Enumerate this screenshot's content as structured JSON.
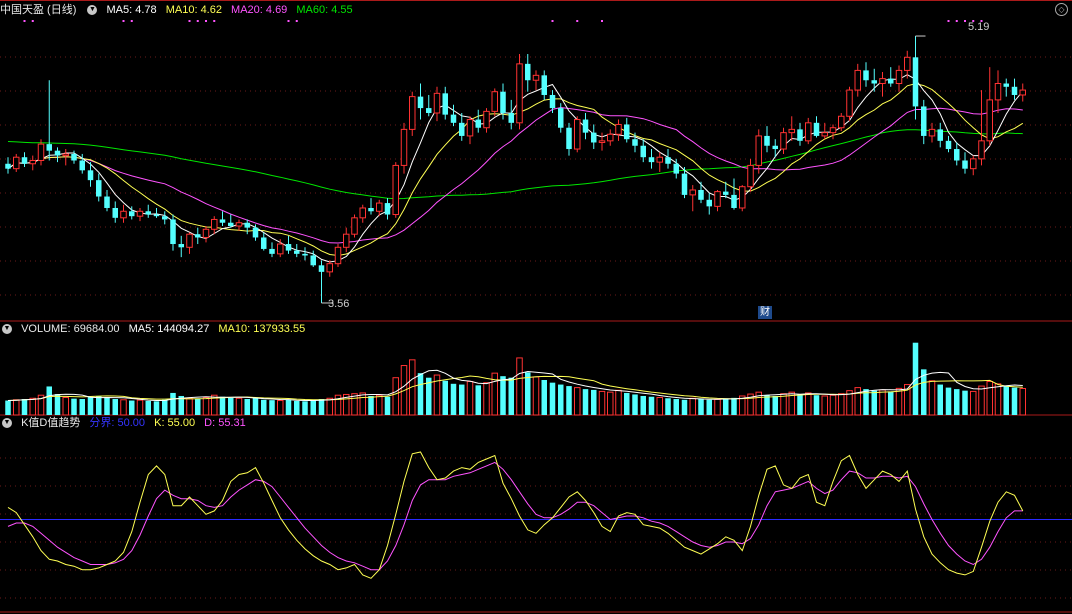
{
  "header": {
    "title": "中国天盈 (日线)",
    "ma5_label": "MA5: 4.78",
    "ma10_label": "MA10: 4.62",
    "ma20_label": "MA20: 4.69",
    "ma60_label": "MA60: 4.55"
  },
  "volume_header": {
    "label": "VOLUME: 69684.00",
    "ma5_label": "MA5: 144094.27",
    "ma10_label": "MA10: 137933.55"
  },
  "kd_header": {
    "title": "K值D值趋势",
    "divider_label": "分界: 50.00",
    "k_label": "K: 55.00",
    "d_label": "D: 55.31"
  },
  "annotations": {
    "high_label": "5.19",
    "low_label": "3.56",
    "finance_marker": "财"
  },
  "colors": {
    "up": "#ff3232",
    "down": "#54ffff",
    "ma5": "#ffffff",
    "ma10": "#ffff54",
    "ma20": "#ff54ff",
    "ma60": "#00e600",
    "panel_border": "#aa1a1a",
    "divider_line": "#2a2aff",
    "k_line": "#ffff54",
    "d_line": "#ff54ff"
  },
  "icons": {
    "panel_toggle": "chevron-down-icon",
    "corner": "expand-icon"
  },
  "chart_data": {
    "type": "candlestick",
    "candles": [
      [
        4.41,
        4.45,
        4.35,
        4.38
      ],
      [
        4.38,
        4.47,
        4.36,
        4.45
      ],
      [
        4.45,
        4.48,
        4.39,
        4.41
      ],
      [
        4.41,
        4.46,
        4.37,
        4.43
      ],
      [
        4.43,
        4.56,
        4.4,
        4.53
      ],
      [
        4.53,
        4.92,
        4.43,
        4.49
      ],
      [
        4.49,
        4.51,
        4.42,
        4.46
      ],
      [
        4.46,
        4.5,
        4.4,
        4.47
      ],
      [
        4.47,
        4.49,
        4.41,
        4.43
      ],
      [
        4.43,
        4.47,
        4.35,
        4.37
      ],
      [
        4.37,
        4.42,
        4.27,
        4.31
      ],
      [
        4.31,
        4.35,
        4.18,
        4.21
      ],
      [
        4.21,
        4.25,
        4.12,
        4.14
      ],
      [
        4.14,
        4.18,
        4.05,
        4.08
      ],
      [
        4.08,
        4.16,
        4.05,
        4.12
      ],
      [
        4.12,
        4.15,
        4.07,
        4.09
      ],
      [
        4.09,
        4.14,
        4.06,
        4.12
      ],
      [
        4.12,
        4.16,
        4.08,
        4.1
      ],
      [
        4.1,
        4.14,
        4.08,
        4.09
      ],
      [
        4.09,
        4.12,
        4.04,
        4.07
      ],
      [
        4.07,
        4.1,
        3.88,
        3.92
      ],
      [
        3.92,
        3.97,
        3.84,
        3.9
      ],
      [
        3.9,
        3.99,
        3.86,
        3.98
      ],
      [
        3.98,
        4.02,
        3.92,
        3.96
      ],
      [
        3.96,
        4.03,
        3.93,
        4.01
      ],
      [
        4.01,
        4.09,
        3.98,
        4.07
      ],
      [
        4.07,
        4.12,
        4.03,
        4.05
      ],
      [
        4.05,
        4.1,
        4.02,
        4.03
      ],
      [
        4.03,
        4.07,
        4.0,
        4.05
      ],
      [
        4.05,
        4.07,
        3.98,
        4.02
      ],
      [
        4.02,
        4.04,
        3.94,
        3.96
      ],
      [
        3.96,
        3.99,
        3.88,
        3.89
      ],
      [
        3.89,
        3.93,
        3.84,
        3.86
      ],
      [
        3.86,
        3.95,
        3.84,
        3.92
      ],
      [
        3.92,
        3.97,
        3.86,
        3.88
      ],
      [
        3.88,
        3.92,
        3.84,
        3.86
      ],
      [
        3.86,
        3.9,
        3.82,
        3.85
      ],
      [
        3.85,
        3.88,
        3.78,
        3.79
      ],
      [
        3.79,
        3.82,
        3.56,
        3.75
      ],
      [
        3.75,
        3.82,
        3.72,
        3.8
      ],
      [
        3.8,
        3.92,
        3.78,
        3.9
      ],
      [
        3.9,
        4.02,
        3.87,
        3.98
      ],
      [
        3.98,
        4.1,
        3.96,
        4.08
      ],
      [
        4.08,
        4.16,
        4.05,
        4.14
      ],
      [
        4.14,
        4.2,
        4.1,
        4.12
      ],
      [
        4.12,
        4.19,
        4.09,
        4.17
      ],
      [
        4.17,
        4.2,
        4.07,
        4.1
      ],
      [
        4.1,
        4.42,
        4.08,
        4.4
      ],
      [
        4.4,
        4.66,
        4.35,
        4.62
      ],
      [
        4.62,
        4.85,
        4.58,
        4.82
      ],
      [
        4.82,
        4.9,
        4.68,
        4.75
      ],
      [
        4.75,
        4.83,
        4.7,
        4.72
      ],
      [
        4.72,
        4.88,
        4.67,
        4.84
      ],
      [
        4.84,
        4.88,
        4.68,
        4.71
      ],
      [
        4.71,
        4.77,
        4.64,
        4.66
      ],
      [
        4.66,
        4.72,
        4.55,
        4.58
      ],
      [
        4.58,
        4.7,
        4.53,
        4.68
      ],
      [
        4.68,
        4.74,
        4.6,
        4.63
      ],
      [
        4.63,
        4.75,
        4.6,
        4.73
      ],
      [
        4.73,
        4.87,
        4.7,
        4.85
      ],
      [
        4.85,
        4.9,
        4.68,
        4.72
      ],
      [
        4.72,
        4.8,
        4.62,
        4.66
      ],
      [
        4.66,
        5.08,
        4.62,
        5.02
      ],
      [
        5.02,
        5.08,
        4.85,
        4.92
      ],
      [
        4.92,
        4.98,
        4.86,
        4.95
      ],
      [
        4.95,
        4.98,
        4.8,
        4.83
      ],
      [
        4.83,
        4.86,
        4.72,
        4.75
      ],
      [
        4.75,
        4.78,
        4.6,
        4.63
      ],
      [
        4.63,
        4.66,
        4.46,
        4.5
      ],
      [
        4.5,
        4.7,
        4.48,
        4.68
      ],
      [
        4.68,
        4.72,
        4.56,
        4.6
      ],
      [
        4.6,
        4.65,
        4.5,
        4.54
      ],
      [
        4.54,
        4.6,
        4.49,
        4.55
      ],
      [
        4.55,
        4.62,
        4.52,
        4.59
      ],
      [
        4.59,
        4.68,
        4.55,
        4.65
      ],
      [
        4.65,
        4.69,
        4.54,
        4.56
      ],
      [
        4.56,
        4.6,
        4.48,
        4.52
      ],
      [
        4.52,
        4.56,
        4.42,
        4.45
      ],
      [
        4.45,
        4.5,
        4.38,
        4.42
      ],
      [
        4.42,
        4.48,
        4.36,
        4.45
      ],
      [
        4.45,
        4.5,
        4.38,
        4.41
      ],
      [
        4.41,
        4.44,
        4.32,
        4.35
      ],
      [
        4.35,
        4.39,
        4.2,
        4.22
      ],
      [
        4.22,
        4.28,
        4.12,
        4.25
      ],
      [
        4.25,
        4.3,
        4.17,
        4.19
      ],
      [
        4.19,
        4.23,
        4.1,
        4.15
      ],
      [
        4.15,
        4.25,
        4.12,
        4.24
      ],
      [
        4.24,
        4.3,
        4.2,
        4.22
      ],
      [
        4.22,
        4.32,
        4.13,
        4.14
      ],
      [
        4.14,
        4.28,
        4.12,
        4.27
      ],
      [
        4.27,
        4.44,
        4.24,
        4.4
      ],
      [
        4.4,
        4.62,
        4.35,
        4.58
      ],
      [
        4.58,
        4.64,
        4.48,
        4.52
      ],
      [
        4.52,
        4.56,
        4.45,
        4.5
      ],
      [
        4.5,
        4.63,
        4.47,
        4.6
      ],
      [
        4.6,
        4.7,
        4.55,
        4.62
      ],
      [
        4.62,
        4.66,
        4.52,
        4.55
      ],
      [
        4.55,
        4.69,
        4.53,
        4.66
      ],
      [
        4.66,
        4.7,
        4.57,
        4.58
      ],
      [
        4.58,
        4.66,
        4.56,
        4.6
      ],
      [
        4.6,
        4.65,
        4.56,
        4.63
      ],
      [
        4.63,
        4.72,
        4.61,
        4.7
      ],
      [
        4.7,
        4.88,
        4.67,
        4.86
      ],
      [
        4.86,
        5.02,
        4.82,
        4.98
      ],
      [
        4.98,
        5.03,
        4.88,
        4.92
      ],
      [
        4.92,
        4.99,
        4.85,
        4.9
      ],
      [
        4.9,
        4.97,
        4.82,
        4.93
      ],
      [
        4.93,
        5.0,
        4.88,
        4.9
      ],
      [
        4.9,
        5.01,
        4.85,
        4.98
      ],
      [
        4.98,
        5.1,
        4.93,
        5.06
      ],
      [
        5.06,
        5.19,
        4.68,
        4.76
      ],
      [
        4.76,
        4.8,
        4.53,
        4.58
      ],
      [
        4.58,
        4.66,
        4.54,
        4.62
      ],
      [
        4.62,
        4.66,
        4.51,
        4.55
      ],
      [
        4.55,
        4.58,
        4.48,
        4.5
      ],
      [
        4.5,
        4.54,
        4.4,
        4.43
      ],
      [
        4.43,
        4.48,
        4.35,
        4.38
      ],
      [
        4.38,
        4.46,
        4.34,
        4.44
      ],
      [
        4.44,
        4.86,
        4.4,
        4.55
      ],
      [
        4.55,
        5.0,
        4.52,
        4.8
      ],
      [
        4.8,
        4.98,
        4.72,
        4.9
      ],
      [
        4.9,
        4.93,
        4.82,
        4.88
      ],
      [
        4.88,
        4.93,
        4.8,
        4.83
      ],
      [
        4.83,
        4.9,
        4.79,
        4.86
      ]
    ],
    "ma_lines": [
      "MA5",
      "MA10",
      "MA20",
      "MA60"
    ],
    "price_range": [
      3.45,
      5.3
    ],
    "high_annotation": 5.19,
    "low_annotation": 3.56,
    "volume": [
      38000,
      40000,
      42000,
      44000,
      52000,
      75000,
      55000,
      46000,
      43000,
      42000,
      48000,
      50000,
      47000,
      42000,
      40000,
      38000,
      39000,
      37000,
      36000,
      40000,
      58000,
      50000,
      44000,
      43000,
      46000,
      52000,
      48000,
      45000,
      44000,
      42000,
      45000,
      40000,
      39000,
      38000,
      41000,
      37000,
      36000,
      39000,
      42000,
      44000,
      52000,
      54000,
      56000,
      58000,
      50000,
      52000,
      48000,
      98000,
      130000,
      145000,
      110000,
      98000,
      105000,
      90000,
      82000,
      80000,
      88000,
      78000,
      85000,
      110000,
      102000,
      98000,
      150000,
      112000,
      100000,
      92000,
      85000,
      80000,
      76000,
      72000,
      68000,
      66000,
      62000,
      60000,
      65000,
      58000,
      54000,
      50000,
      48000,
      46000,
      44000,
      42000,
      40000,
      44000,
      42000,
      40000,
      41000,
      43000,
      45000,
      50000,
      55000,
      60000,
      52000,
      50000,
      56000,
      60000,
      54000,
      58000,
      52000,
      50000,
      52000,
      56000,
      64000,
      72000,
      68000,
      64000,
      66000,
      62000,
      70000,
      80000,
      190000,
      120000,
      90000,
      80000,
      72000,
      68000,
      64000,
      62000,
      76000,
      88000,
      82000,
      76000,
      72000,
      69684
    ],
    "volume_range": [
      0,
      205000
    ],
    "kd": {
      "k": [
        57,
        54,
        47,
        40,
        32,
        27,
        26,
        24,
        23,
        21,
        21,
        22,
        24,
        26,
        31,
        43,
        60,
        76,
        81,
        76,
        58,
        58,
        63,
        58,
        53,
        55,
        61,
        72,
        76,
        77,
        80,
        71,
        61,
        51,
        44,
        38,
        33,
        29,
        26,
        24,
        21,
        22,
        24,
        18,
        16,
        21,
        35,
        53,
        72,
        88,
        89,
        80,
        73,
        74,
        78,
        80,
        79,
        83,
        85,
        87,
        71,
        62,
        52,
        44,
        42,
        47,
        51,
        57,
        63,
        66,
        61,
        54,
        46,
        43,
        52,
        54,
        53,
        47,
        46,
        45,
        42,
        38,
        34,
        32,
        30,
        33,
        36,
        40,
        38,
        32,
        46,
        64,
        79,
        81,
        70,
        68,
        74,
        76,
        60,
        58,
        72,
        84,
        87,
        76,
        68,
        73,
        78,
        76,
        72,
        78,
        56,
        40,
        30,
        25,
        21,
        19,
        18,
        20,
        34,
        49,
        60,
        66,
        64,
        55
      ],
      "d": [
        46,
        48,
        48,
        46,
        42,
        38,
        34,
        31,
        28,
        26,
        24,
        24,
        24,
        25,
        27,
        32,
        41,
        52,
        62,
        67,
        64,
        62,
        62,
        61,
        58,
        57,
        58,
        63,
        67,
        70,
        73,
        72,
        69,
        63,
        57,
        51,
        45,
        40,
        35,
        31,
        28,
        26,
        25,
        23,
        21,
        21,
        26,
        35,
        47,
        61,
        70,
        73,
        73,
        73,
        75,
        76,
        77,
        79,
        81,
        83,
        79,
        73,
        66,
        59,
        53,
        51,
        51,
        53,
        56,
        60,
        60,
        58,
        54,
        50,
        51,
        52,
        52,
        51,
        49,
        48,
        46,
        43,
        40,
        37,
        35,
        34,
        35,
        37,
        37,
        36,
        39,
        47,
        58,
        66,
        67,
        68,
        70,
        72,
        68,
        65,
        67,
        73,
        78,
        77,
        74,
        74,
        75,
        75,
        74,
        75,
        69,
        59,
        50,
        42,
        35,
        30,
        26,
        24,
        27,
        34,
        43,
        51,
        55,
        55
      ],
      "divider": 50,
      "range": [
        0,
        100
      ]
    }
  }
}
